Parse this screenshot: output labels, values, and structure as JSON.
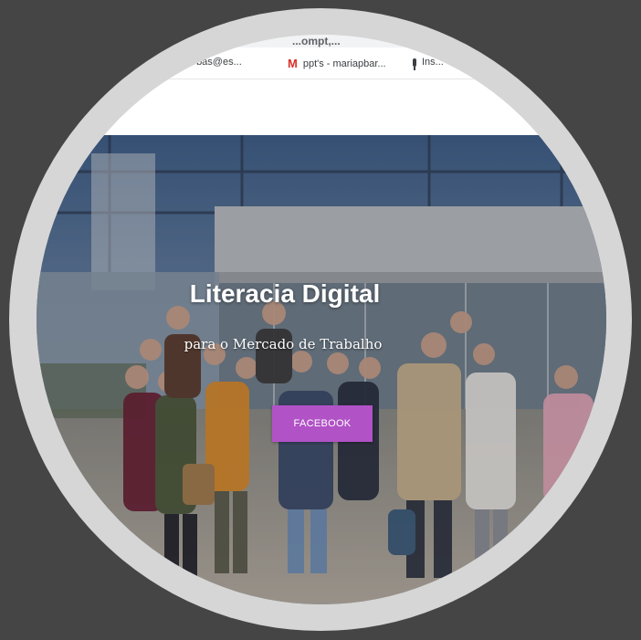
{
  "browser": {
    "url_fragment": "...ompt,...",
    "bookmarks": [
      {
        "icon": "mail-icon",
        "label": "...barbas@es..."
      },
      {
        "icon": "gmail-icon",
        "label": "ppt's - mariapbar..."
      },
      {
        "icon": "mic-icon",
        "label": "Ins..."
      }
    ]
  },
  "hero": {
    "title": "Literacia Digital",
    "subtitle": "para o Mercado de Trabalho",
    "button_label": "FACEBOOK"
  },
  "colors": {
    "background": "#454545",
    "ring": "#d6d6d6",
    "button": "#b152c6"
  }
}
